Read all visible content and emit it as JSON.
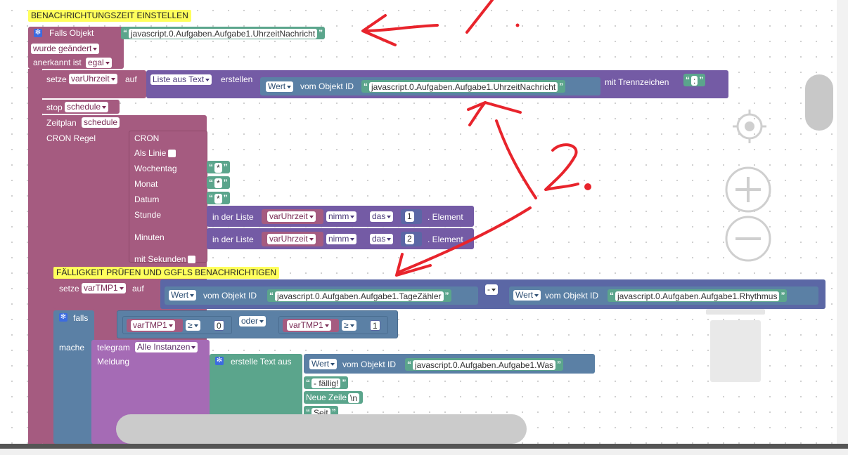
{
  "comments": {
    "c1": "BENACHRICHTUNGSZEIT EINSTELLEN",
    "c2": "FÄLLIGKEIT PRÜFEN UND GGFLS BENACHRICHTIGEN"
  },
  "trigger": {
    "falls_objekt": "Falls Objekt",
    "object_id": "javascript.0.Aufgaben.Aufgabe1.UhrzeitNachricht",
    "wurde": "wurde geändert",
    "anerkannt_label": "anerkannt ist",
    "anerkannt_value": "egal"
  },
  "set1": {
    "setze": "setze",
    "var": "varUhrzeit",
    "auf": "auf",
    "liste": "Liste aus Text",
    "erstellen": "erstellen",
    "wert": "Wert",
    "vom_objekt": "vom Objekt ID",
    "object_id": "javascript.0.Aufgaben.Aufgabe1.UhrzeitNachricht",
    "trenn": "mit Trennzeichen",
    "sep": ":"
  },
  "stop": {
    "label": "stop",
    "value": "schedule"
  },
  "zeitplan": {
    "label": "Zeitplan",
    "value": "schedule"
  },
  "cron": {
    "regel": "CRON Regel",
    "title": "CRON",
    "als_linie": "Als Linie",
    "wochentag": "Wochentag",
    "monat": "Monat",
    "datum": "Datum",
    "stunde": "Stunde",
    "minuten": "Minuten",
    "sekunden": "mit Sekunden",
    "star": "*",
    "in_liste": "in der Liste",
    "list_var": "varUhrzeit",
    "nimm": "nimm",
    "das": "das",
    "idx1": "1",
    "idx2": "2",
    "element": ". Element"
  },
  "set2": {
    "setze": "setze",
    "var": "varTMP1",
    "auf": "auf",
    "wert": "Wert",
    "vom_objekt": "vom Objekt ID",
    "id1": "javascript.0.Aufgaben.Aufgabe1.TageZähler",
    "op": "-",
    "id2": "javascript.0.Aufgaben.Aufgabe1.Rhythmus"
  },
  "cond": {
    "falls": "falls",
    "var": "varTMP1",
    "ge": "≥",
    "v1": "0",
    "oder": "oder",
    "v2": "1"
  },
  "mache": {
    "label": "mache",
    "telegram": "telegram",
    "instanzen": "Alle Instanzen",
    "meldung": "Meldung",
    "erstelle": "erstelle Text aus",
    "wert": "Wert",
    "vom_objekt": "vom Objekt ID",
    "id_was": "javascript.0.Aufgaben.Aufgabe1.Was",
    "faellig": " - fällig!",
    "neue_zeile": "Neue Zeile",
    "nl": "\\n",
    "seit": " Seit "
  },
  "annotations": {
    "one": "1.",
    "two": "2."
  }
}
